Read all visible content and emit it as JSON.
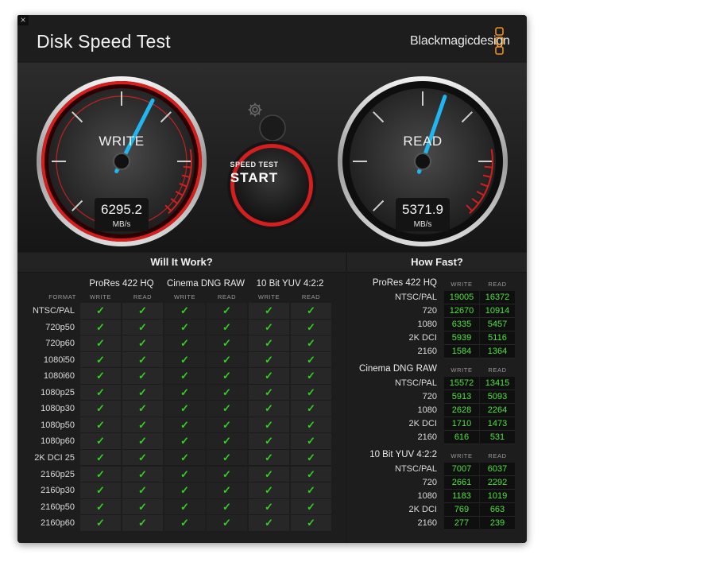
{
  "window": {
    "close_glyph": "×",
    "title": "Disk Speed Test",
    "brand": "Blackmagicdesign"
  },
  "gauges": {
    "write": {
      "label": "WRITE",
      "value": "6295.2",
      "unit": "MB/s",
      "needle_fraction": 0.6
    },
    "read": {
      "label": "READ",
      "value": "5371.9",
      "unit": "MB/s",
      "needle_fraction": 0.57
    },
    "start_small": "SPEED TEST",
    "start_big": "START",
    "gear_icon": "gear-icon",
    "colors": {
      "ring_red": "#d41f1f",
      "needle": "#20b6f0",
      "check": "#31d31f",
      "number": "#4ee33b"
    }
  },
  "will_it_work": {
    "title": "Will It Work?",
    "format_label": "FORMAT",
    "groups": [
      "ProRes 422 HQ",
      "Cinema DNG RAW",
      "10 Bit YUV 4:2:2"
    ],
    "subcols": [
      "WRITE",
      "READ"
    ],
    "check_glyph": "✓",
    "rows": [
      "NTSC/PAL",
      "720p50",
      "720p60",
      "1080i50",
      "1080i60",
      "1080p25",
      "1080p30",
      "1080p50",
      "1080p60",
      "2K DCI 25",
      "2160p25",
      "2160p30",
      "2160p50",
      "2160p60"
    ]
  },
  "how_fast": {
    "title": "How Fast?",
    "subcols": [
      "WRITE",
      "READ"
    ],
    "groups": [
      {
        "name": "ProRes 422 HQ",
        "rows": [
          {
            "label": "NTSC/PAL",
            "write": "19005",
            "read": "16372"
          },
          {
            "label": "720",
            "write": "12670",
            "read": "10914"
          },
          {
            "label": "1080",
            "write": "6335",
            "read": "5457"
          },
          {
            "label": "2K DCI",
            "write": "5939",
            "read": "5116"
          },
          {
            "label": "2160",
            "write": "1584",
            "read": "1364"
          }
        ]
      },
      {
        "name": "Cinema DNG RAW",
        "rows": [
          {
            "label": "NTSC/PAL",
            "write": "15572",
            "read": "13415"
          },
          {
            "label": "720",
            "write": "5913",
            "read": "5093"
          },
          {
            "label": "1080",
            "write": "2628",
            "read": "2264"
          },
          {
            "label": "2K DCI",
            "write": "1710",
            "read": "1473"
          },
          {
            "label": "2160",
            "write": "616",
            "read": "531"
          }
        ]
      },
      {
        "name": "10 Bit YUV 4:2:2",
        "rows": [
          {
            "label": "NTSC/PAL",
            "write": "7007",
            "read": "6037"
          },
          {
            "label": "720",
            "write": "2661",
            "read": "2292"
          },
          {
            "label": "1080",
            "write": "1183",
            "read": "1019"
          },
          {
            "label": "2K DCI",
            "write": "769",
            "read": "663"
          },
          {
            "label": "2160",
            "write": "277",
            "read": "239"
          }
        ]
      }
    ]
  }
}
